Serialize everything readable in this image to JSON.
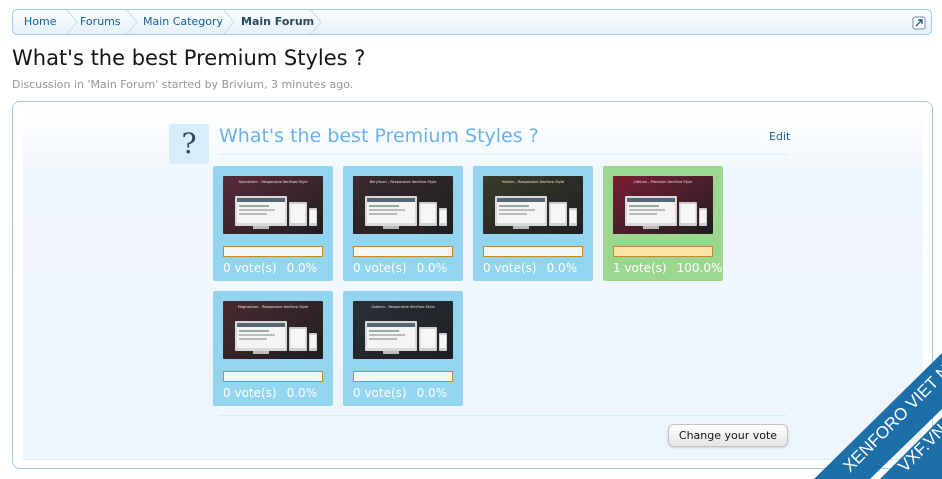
{
  "breadcrumb": {
    "items": [
      {
        "label": "Home"
      },
      {
        "label": "Forums"
      },
      {
        "label": "Main Category"
      },
      {
        "label": "Main Forum"
      }
    ],
    "jump_icon": "external-link-icon"
  },
  "thread": {
    "title": "What's the best Premium Styles ?",
    "description_prefix": "Discussion in '",
    "forum": "Main Forum",
    "description_mid": "' started by ",
    "author": "Brivium",
    "time": ", 3 minutes ago."
  },
  "poll": {
    "badge": "?",
    "question": "What's the best Premium Styles ?",
    "edit_label": "Edit",
    "options": [
      {
        "votes_text": "0 vote(s)",
        "percent_text": "0.0%",
        "percent": 0,
        "thumb_caption": "Aluminium - Responsive XenForo Style",
        "thumb_color": "#5a2a3a"
      },
      {
        "votes_text": "0 vote(s)",
        "percent_text": "0.0%",
        "percent": 0,
        "thumb_caption": "Beryllium - Responsive XenForo Style",
        "thumb_color": "#3a2a2e"
      },
      {
        "votes_text": "0 vote(s)",
        "percent_text": "0.0%",
        "percent": 0,
        "thumb_caption": "Helium - Responsive XenForo Style",
        "thumb_color": "#3b3b2a"
      },
      {
        "votes_text": "1 vote(s)",
        "percent_text": "100.0%",
        "percent": 100,
        "thumb_caption": "Lithium - Premium XenForo Style",
        "thumb_color": "#7a1e34"
      },
      {
        "votes_text": "0 vote(s)",
        "percent_text": "0.0%",
        "percent": 0,
        "thumb_caption": "Magnesium - Responsive XenForo Style",
        "thumb_color": "#4a2a30"
      },
      {
        "votes_text": "0 vote(s)",
        "percent_text": "0.0%",
        "percent": 0,
        "thumb_caption": "Sodium - Responsive XenForo Style",
        "thumb_color": "#2a3038"
      }
    ],
    "change_vote_label": "Change your vote"
  },
  "watermark": {
    "line1": "XENFORO VIET NAM",
    "line2": "VXF.VN"
  },
  "colors": {
    "option_bg": "#93d4ee",
    "winner_bg": "#9bd78e",
    "link": "#176093",
    "question": "#6cb2e4",
    "watermark": "#1d6fa8"
  }
}
